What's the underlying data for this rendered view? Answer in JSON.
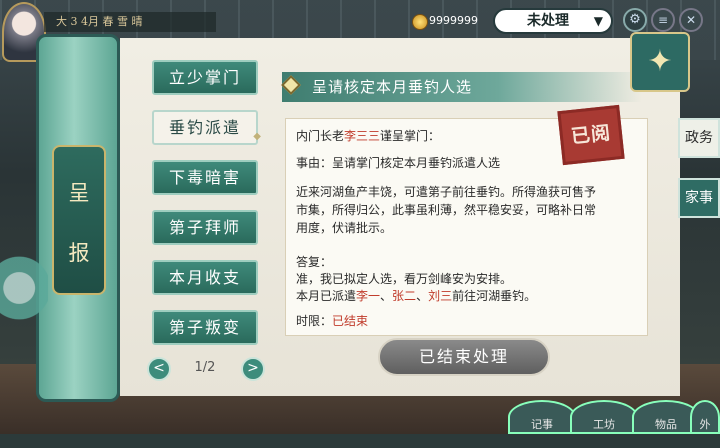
{
  "top_bar": {
    "title": "大 3 4月 春 雪 晴",
    "currency_1": "9999999",
    "currency_2": "9999999",
    "filter": {
      "selected": "未处理",
      "icon": "chevron-down-icon"
    }
  },
  "side_scroll": {
    "label_1": "呈",
    "label_2": "报"
  },
  "nav": {
    "items": [
      "立少掌门",
      "垂钓派遣",
      "下毒暗害",
      "第子拜师",
      "本月收支",
      "第子叛变"
    ],
    "active_index": 1,
    "page": "1/2"
  },
  "report": {
    "title": "呈请核定本月垂钓人选",
    "greeting_prefix": "内门长老",
    "greeting_name": "李三三",
    "greeting_suffix": "谨呈掌门：",
    "reason": "事由：呈请掌门核定本月垂钓派遣人选",
    "body_1": "近来河湖鱼产丰饶，可遣第子前往垂钓。所得渔获可售予",
    "body_2": "市集，所得归公，此事虽利薄，然平稳安妥，可略补日常",
    "body_3": "用度，伏请批示。",
    "reply_label": "答复：",
    "reply_1": "准，我已拟定人选，看万剑峰安为安排。",
    "reply_2_prefix": "本月已派遣",
    "reply_2_name_1": "李一",
    "reply_2_sep_1": "、",
    "reply_2_name_2": "张二",
    "reply_2_sep_2": "、",
    "reply_2_name_3": "刘三",
    "reply_2_suffix": "前往河湖垂钓。",
    "deadline_label": "时限：",
    "deadline_value": "已结束",
    "stamp": "已阅",
    "action_button": "已结束处理"
  },
  "right_tabs": [
    "政务",
    "家事"
  ],
  "bottom_nav": [
    "记事",
    "工坊",
    "物品",
    "外"
  ],
  "colors": {
    "accent_teal": "#3f8a7b",
    "highlight_red": "#c03a2a",
    "stamp_red": "#a83a33"
  }
}
